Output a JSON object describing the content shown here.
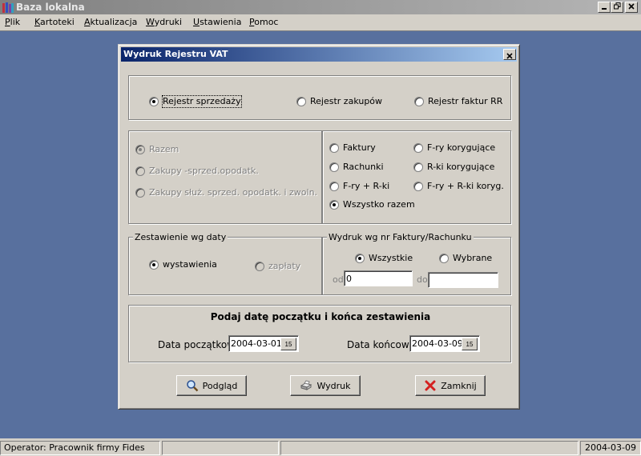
{
  "window": {
    "title": "Baza lokalna"
  },
  "menu": [
    "Plik",
    "Kartoteki",
    "Aktualizacja",
    "Wydruki",
    "Ustawienia",
    "Pomoc"
  ],
  "dialog": {
    "title": "Wydruk Rejestru VAT",
    "register_type": {
      "options": [
        "Rejestr sprzedaży",
        "Rejestr zakupów",
        "Rejestr faktur RR"
      ],
      "selected": "Rejestr sprzedaży"
    },
    "purchase_kind": {
      "options": [
        "Razem",
        "Zakupy -sprzed.opodatk.",
        "Zakupy służ. sprzed. opodatk. i zwoln."
      ],
      "selected": "Razem",
      "enabled": false
    },
    "document_type": {
      "left": [
        "Faktury",
        "Rachunki",
        "F-ry + R-ki",
        "Wszystko razem"
      ],
      "right": [
        "F-ry korygujące",
        "R-ki korygujące",
        "F-ry + R-ki koryg."
      ],
      "selected": "Wszystko razem"
    },
    "date_grouping": {
      "label": "Zestawienie wg daty",
      "options": [
        "wystawienia",
        "zapłaty"
      ],
      "selected": "wystawienia"
    },
    "number_filter": {
      "label": "Wydruk wg nr Faktury/Rachunku",
      "options": [
        "Wszystkie",
        "Wybrane"
      ],
      "selected": "Wszystkie",
      "from_label": "od",
      "from_value": "0",
      "to_label": "do",
      "to_value": ""
    },
    "date_range": {
      "heading": "Podaj datę początku i końca zestawienia",
      "start_label": "Data początkowa",
      "start_value": "2004-03-01",
      "end_label": "Data końcowa",
      "end_value": "2004-03-09",
      "calendar_glyph": "15"
    },
    "buttons": {
      "preview": "Podgląd",
      "print": "Wydruk",
      "close": "Zamknij"
    }
  },
  "status": {
    "operator": "Operator: Pracownik firmy Fides",
    "date": "2004-03-09"
  }
}
